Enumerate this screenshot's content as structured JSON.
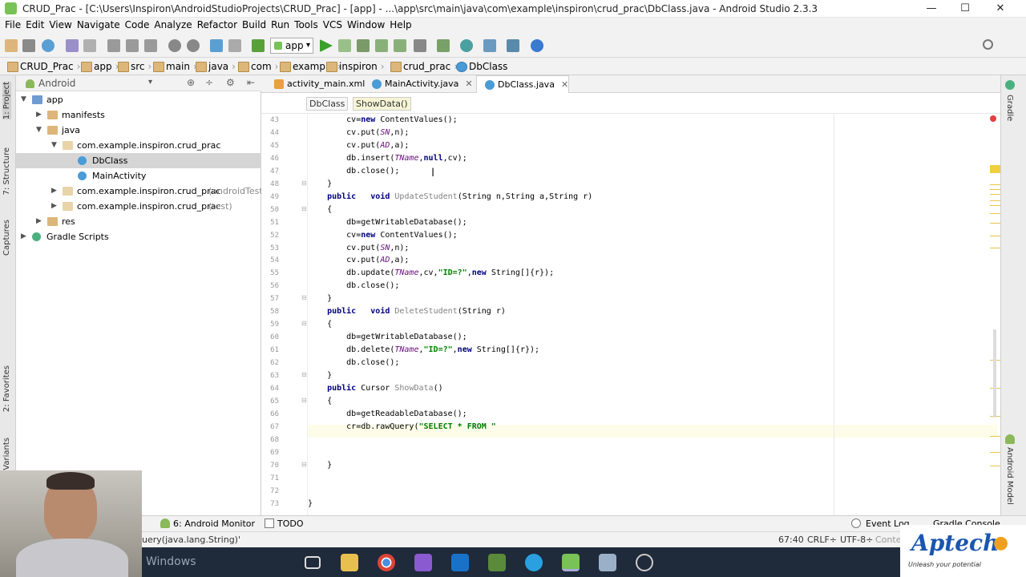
{
  "window": {
    "title": "CRUD_Prac - [C:\\Users\\Inspiron\\AndroidStudioProjects\\CRUD_Prac] - [app] - ...\\app\\src\\main\\java\\com\\example\\inspiron\\crud_prac\\DbClass.java - Android Studio 2.3.3",
    "minimize": "—",
    "maximize": "☐",
    "close": "✕"
  },
  "menu": [
    "File",
    "Edit",
    "View",
    "Navigate",
    "Code",
    "Analyze",
    "Refactor",
    "Build",
    "Run",
    "Tools",
    "VCS",
    "Window",
    "Help"
  ],
  "toolbar": {
    "run_config": "app"
  },
  "breadcrumbs": [
    "CRUD_Prac",
    "app",
    "src",
    "main",
    "java",
    "com",
    "example",
    "inspiron",
    "crud_prac",
    "DbClass"
  ],
  "project": {
    "view": "Android",
    "tree": [
      {
        "label": "app",
        "depth": 0,
        "icon": "folder-app",
        "expanded": true
      },
      {
        "label": "manifests",
        "depth": 1,
        "icon": "folder",
        "expanded": false
      },
      {
        "label": "java",
        "depth": 1,
        "icon": "folder",
        "expanded": true
      },
      {
        "label": "com.example.inspiron.crud_prac",
        "depth": 2,
        "icon": "package",
        "expanded": true
      },
      {
        "label": "DbClass",
        "depth": 3,
        "icon": "class",
        "selected": true
      },
      {
        "label": "MainActivity",
        "depth": 3,
        "icon": "class"
      },
      {
        "label": "com.example.inspiron.crud_prac",
        "suffix": "(androidTest)",
        "depth": 2,
        "icon": "package",
        "expanded": false
      },
      {
        "label": "com.example.inspiron.crud_prac",
        "suffix": "(test)",
        "depth": 2,
        "icon": "package",
        "expanded": false
      },
      {
        "label": "res",
        "depth": 1,
        "icon": "folder-res",
        "expanded": false
      },
      {
        "label": "Gradle Scripts",
        "depth": 0,
        "icon": "gradle",
        "expanded": false
      }
    ]
  },
  "left_tool_tabs": [
    "1: Project",
    "7: Structure",
    "Captures",
    "2: Favorites",
    "Build Variants"
  ],
  "right_tool_tabs": [
    "Gradle",
    "Android Model"
  ],
  "editor_tabs": [
    {
      "label": "activity_main.xml",
      "icon": "xml"
    },
    {
      "label": "MainActivity.java",
      "icon": "class"
    },
    {
      "label": "DbClass.java",
      "icon": "class",
      "active": true
    }
  ],
  "code_breadcrumb": [
    "DbClass",
    "ShowData()"
  ],
  "code": [
    {
      "n": "43",
      "t": [
        [
          "",
          "        cv="
        ],
        [
          "kw",
          "new"
        ],
        [
          "",
          " ContentValues();"
        ]
      ]
    },
    {
      "n": "44",
      "t": [
        [
          "",
          "        cv.put("
        ],
        [
          "fld",
          "SN"
        ],
        [
          "",
          ",n);"
        ]
      ]
    },
    {
      "n": "45",
      "t": [
        [
          "",
          "        cv.put("
        ],
        [
          "fld",
          "AD"
        ],
        [
          "",
          ",a);"
        ]
      ]
    },
    {
      "n": "46",
      "t": [
        [
          "",
          "        db.insert("
        ],
        [
          "fld",
          "TName"
        ],
        [
          "",
          ","
        ],
        [
          "kw",
          "null"
        ],
        [
          "",
          ",cv);"
        ]
      ]
    },
    {
      "n": "47",
      "t": [
        [
          "",
          "        db.close();"
        ]
      ]
    },
    {
      "n": "48",
      "t": [
        [
          "",
          "    }"
        ]
      ]
    },
    {
      "n": "49",
      "t": [
        [
          "kw",
          "    public"
        ],
        [
          "",
          "   "
        ],
        [
          "kw",
          "void"
        ],
        [
          "",
          " "
        ],
        [
          "fn",
          "UpdateStudent"
        ],
        [
          "",
          "(String n,String a,String r)"
        ]
      ]
    },
    {
      "n": "50",
      "t": [
        [
          "",
          "    {"
        ]
      ]
    },
    {
      "n": "51",
      "t": [
        [
          "",
          "        db=getWritableDatabase();"
        ]
      ]
    },
    {
      "n": "52",
      "t": [
        [
          "",
          "        cv="
        ],
        [
          "kw",
          "new"
        ],
        [
          "",
          " ContentValues();"
        ]
      ]
    },
    {
      "n": "53",
      "t": [
        [
          "",
          "        cv.put("
        ],
        [
          "fld",
          "SN"
        ],
        [
          "",
          ",n);"
        ]
      ]
    },
    {
      "n": "54",
      "t": [
        [
          "",
          "        cv.put("
        ],
        [
          "fld",
          "AD"
        ],
        [
          "",
          ",a);"
        ]
      ]
    },
    {
      "n": "55",
      "t": [
        [
          "",
          "        db.update("
        ],
        [
          "fld",
          "TName"
        ],
        [
          "",
          ",cv,"
        ],
        [
          "str",
          "\"ID=?\""
        ],
        [
          "",
          ","
        ],
        [
          "kw",
          "new"
        ],
        [
          "",
          " String[]{r});"
        ]
      ]
    },
    {
      "n": "56",
      "t": [
        [
          "",
          "        db.close();"
        ]
      ]
    },
    {
      "n": "57",
      "t": [
        [
          "",
          "    }"
        ]
      ]
    },
    {
      "n": "58",
      "t": [
        [
          "kw",
          "    public"
        ],
        [
          "",
          "   "
        ],
        [
          "kw",
          "void"
        ],
        [
          "",
          " "
        ],
        [
          "fn",
          "DeleteStudent"
        ],
        [
          "",
          "(String r)"
        ]
      ]
    },
    {
      "n": "59",
      "t": [
        [
          "",
          "    {"
        ]
      ]
    },
    {
      "n": "60",
      "t": [
        [
          "",
          "        db=getWritableDatabase();"
        ]
      ]
    },
    {
      "n": "61",
      "t": [
        [
          "",
          "        db.delete("
        ],
        [
          "fld",
          "TName"
        ],
        [
          "",
          ","
        ],
        [
          "str",
          "\"ID=?\""
        ],
        [
          "",
          ","
        ],
        [
          "kw",
          "new"
        ],
        [
          "",
          " String[]{r});"
        ]
      ]
    },
    {
      "n": "62",
      "t": [
        [
          "",
          "        db.close();"
        ]
      ]
    },
    {
      "n": "63",
      "t": [
        [
          "",
          "    }"
        ]
      ]
    },
    {
      "n": "64",
      "t": [
        [
          "kw",
          "    public"
        ],
        [
          "",
          " Cursor "
        ],
        [
          "fn",
          "ShowData"
        ],
        [
          "",
          "()"
        ]
      ]
    },
    {
      "n": "65",
      "t": [
        [
          "",
          "    {"
        ]
      ]
    },
    {
      "n": "66",
      "t": [
        [
          "",
          "        db=getReadableDatabase();"
        ]
      ]
    },
    {
      "n": "67",
      "t": [
        [
          "",
          "        cr=db.rawQuery("
        ],
        [
          "str",
          "\"SELECT * FROM \""
        ]
      ]
    },
    {
      "n": "68",
      "t": [
        [
          "",
          ""
        ]
      ]
    },
    {
      "n": "69",
      "t": [
        [
          "",
          ""
        ]
      ]
    },
    {
      "n": "70",
      "t": [
        [
          "",
          "    }"
        ]
      ]
    },
    {
      "n": "71",
      "t": [
        [
          "",
          ""
        ]
      ]
    },
    {
      "n": "72",
      "t": [
        [
          "",
          ""
        ]
      ]
    },
    {
      "n": "73",
      "t": [
        [
          "",
          "}"
        ]
      ]
    }
  ],
  "bottom_tabs": [
    "6: Android Monitor",
    "TODO",
    "Event Log",
    "Gradle Console"
  ],
  "status": {
    "message": "uery(java.lang.String)'",
    "position": "67:40",
    "line_sep": "CRLF÷",
    "encoding": "UTF-8÷",
    "context": "Conte"
  },
  "taskbar": {
    "activate_text": "Windows"
  },
  "watermark": {
    "brand": "Aptech",
    "tagline": "Unleash your potential"
  }
}
